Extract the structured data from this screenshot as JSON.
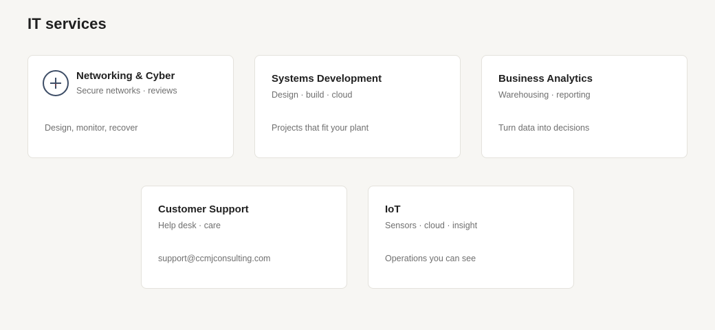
{
  "page": {
    "title": "IT services"
  },
  "cards": [
    {
      "title": "Networking & Cyber",
      "subtitle": "Secure networks · reviews",
      "description": "Design, monitor, recover",
      "icon": "plus-icon"
    },
    {
      "title": "Systems Development",
      "subtitle": "Design · build · cloud",
      "description": "Projects that fit your plant"
    },
    {
      "title": "Business Analytics",
      "subtitle": "Warehousing · reporting",
      "description": "Turn data into decisions"
    },
    {
      "title": "Customer Support",
      "subtitle": "Help desk · care",
      "description": "support@ccmjconsulting.com"
    },
    {
      "title": "IoT",
      "subtitle": "Sensors · cloud · insight",
      "description": "Operations you can see"
    }
  ],
  "colors": {
    "background": "#f7f6f3",
    "card": "#ffffff",
    "card_border": "#e4e2dc",
    "icon_stroke": "#3d4d66",
    "icon_accent": "#c0392b"
  }
}
